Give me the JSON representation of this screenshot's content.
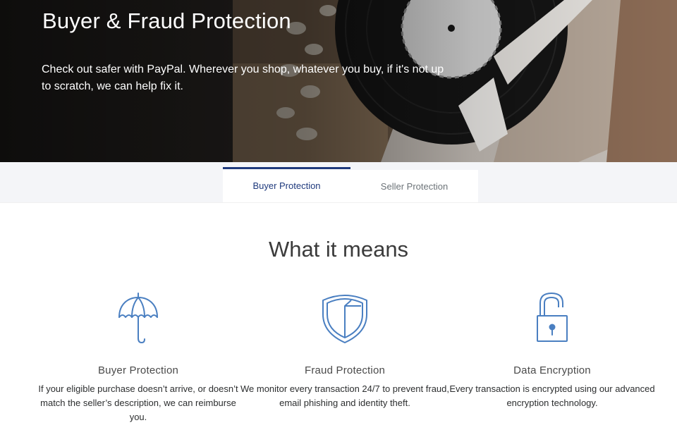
{
  "hero": {
    "title": "Buyer & Fraud Protection",
    "text": "Check out safer with PayPal. Wherever you shop, whatever you buy, if it's not up to scratch, we can help fix it."
  },
  "tabs": [
    {
      "label": "Buyer Protection",
      "active": true
    },
    {
      "label": "Seller Protection",
      "active": false
    }
  ],
  "section": {
    "title": "What it means"
  },
  "features": [
    {
      "icon": "umbrella-icon",
      "title": "Buyer Protection",
      "text": "If your eligible purchase doesn’t arrive, or doesn’t match the seller’s description, we can reimburse you."
    },
    {
      "icon": "shield-icon",
      "title": "Fraud Protection",
      "text": "We monitor every transaction 24/7 to prevent fraud, email phishing and identity theft."
    },
    {
      "icon": "padlock-icon",
      "title": "Data Encryption",
      "text": "Every transaction is encrypted using our advanced encryption technology."
    }
  ],
  "colors": {
    "accent": "#1f3a7d",
    "icon_blue": "#4a7fc1",
    "tab_bar_bg": "#f4f5f8"
  }
}
